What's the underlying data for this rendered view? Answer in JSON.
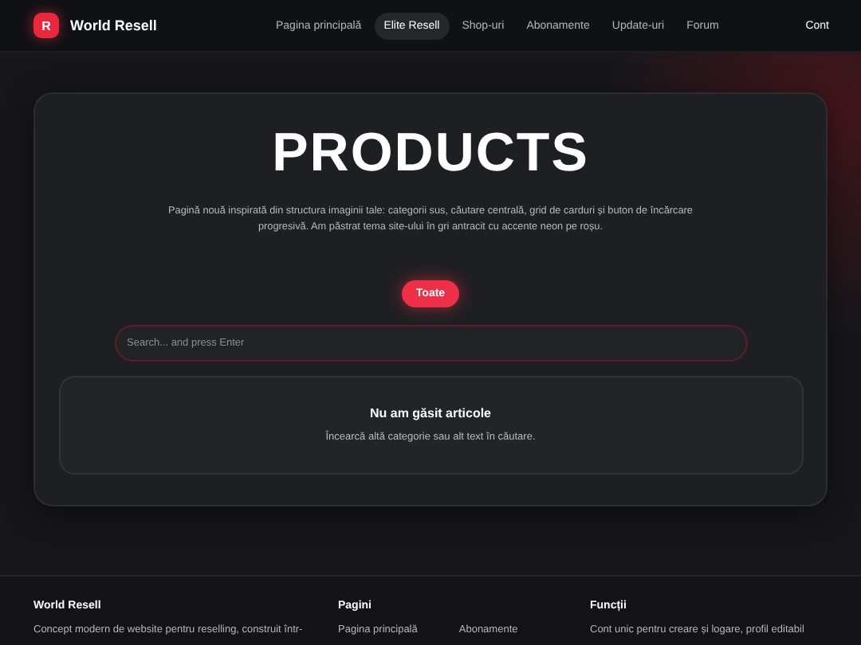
{
  "header": {
    "logo_letter": "R",
    "brand": "World Resell",
    "nav": [
      {
        "label": "Pagina principală",
        "selected": false
      },
      {
        "label": "Elite Resell",
        "selected": true
      },
      {
        "label": "Shop-uri",
        "selected": false
      },
      {
        "label": "Abonamente",
        "selected": false
      },
      {
        "label": "Update-uri",
        "selected": false
      },
      {
        "label": "Forum",
        "selected": false
      }
    ],
    "account": "Cont"
  },
  "hero": {
    "title": "PRODUCTS",
    "description": "Pagină nouă inspirată din structura imaginii tale: categorii sus, căutare centrală, grid de carduri și buton de încărcare progresivă. Am păstrat tema site-ului în gri antracit cu accente neon pe roșu.",
    "categories": [
      {
        "label": "Toate",
        "selected": true
      }
    ],
    "search": {
      "placeholder": "Search... and press Enter"
    },
    "empty_state": {
      "title": "Nu am găsit articole",
      "message": "Încearcă altă categorie sau alt text în căutare."
    }
  },
  "footer": {
    "brand": {
      "title": "World Resell",
      "text": "Concept modern de website pentru reselling, construit într-"
    },
    "pages": {
      "title": "Pagini",
      "links": [
        "Pagina principală",
        "Abonamente"
      ]
    },
    "features": {
      "title": "Funcții",
      "text": "Cont unic pentru creare și logare, profil editabil"
    }
  }
}
